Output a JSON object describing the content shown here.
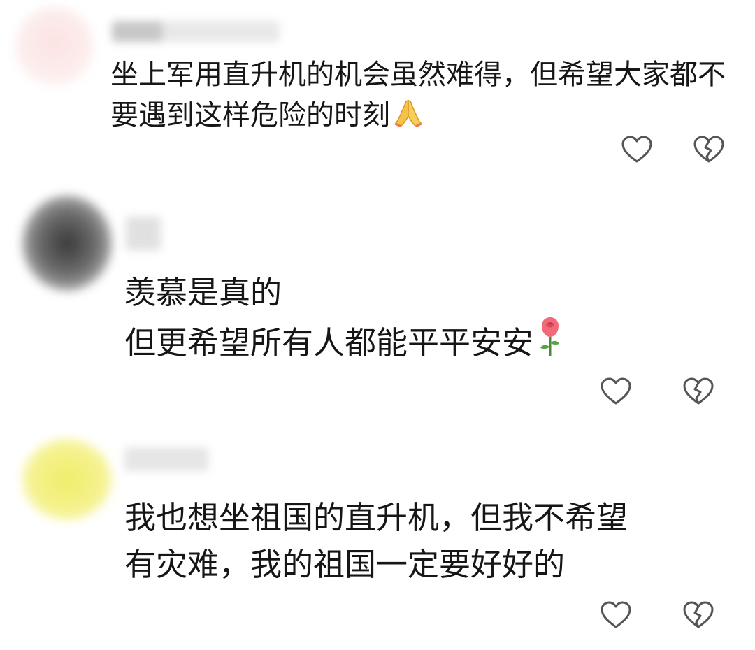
{
  "comments": [
    {
      "text": "坐上军用直升机的机会虽然难得，但希望大家都不\n要遇到这样危险的时刻",
      "emoji": "folded-hands-icon",
      "avatar_color": "#fbe2e2"
    },
    {
      "text": "羡慕是真的\n但更希望所有人都能平平安安",
      "emoji": "rose-icon",
      "avatar_color": "#555555"
    },
    {
      "text": "我也想坐祖国的直升机，但我不希望\n有灾难，我的祖国一定要好好的",
      "avatar_color": "#f0ed6a"
    }
  ],
  "icons": {
    "like": "heart-outline-icon",
    "dislike": "broken-heart-outline-icon"
  },
  "colors": {
    "text": "#161616",
    "icon_stroke": "#555555"
  }
}
